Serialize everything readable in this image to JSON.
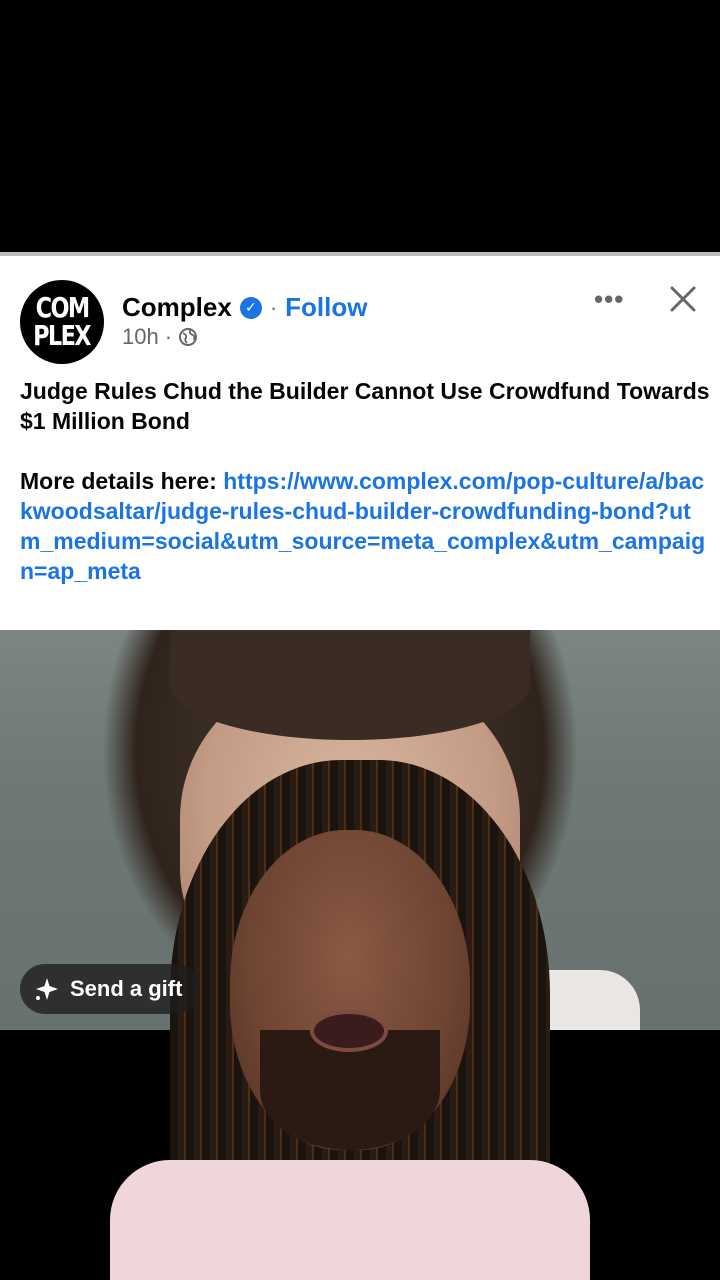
{
  "post": {
    "page_name": "Complex",
    "avatar_text": [
      "COM",
      "PLEX"
    ],
    "separator": "·",
    "follow_label": "Follow",
    "time": "10h",
    "meta_separator": "·",
    "more_label": "•••",
    "headline": "Judge Rules Chud the Builder Cannot Use Crowdfund Towards $1 Million Bond",
    "details_prefix": "More details here: ",
    "link": "https://www.complex.com/pop-culture/a/backwoodsaltar/judge-rules-chud-builder-crowdfunding-bond?utm_medium=social&utm_source=meta_complex&utm_campaign=ap_meta"
  },
  "overlay": {
    "gift_label": "Send a gift"
  },
  "colors": {
    "accent": "#1b74e4",
    "text": "#050505",
    "muted": "#65676b"
  }
}
